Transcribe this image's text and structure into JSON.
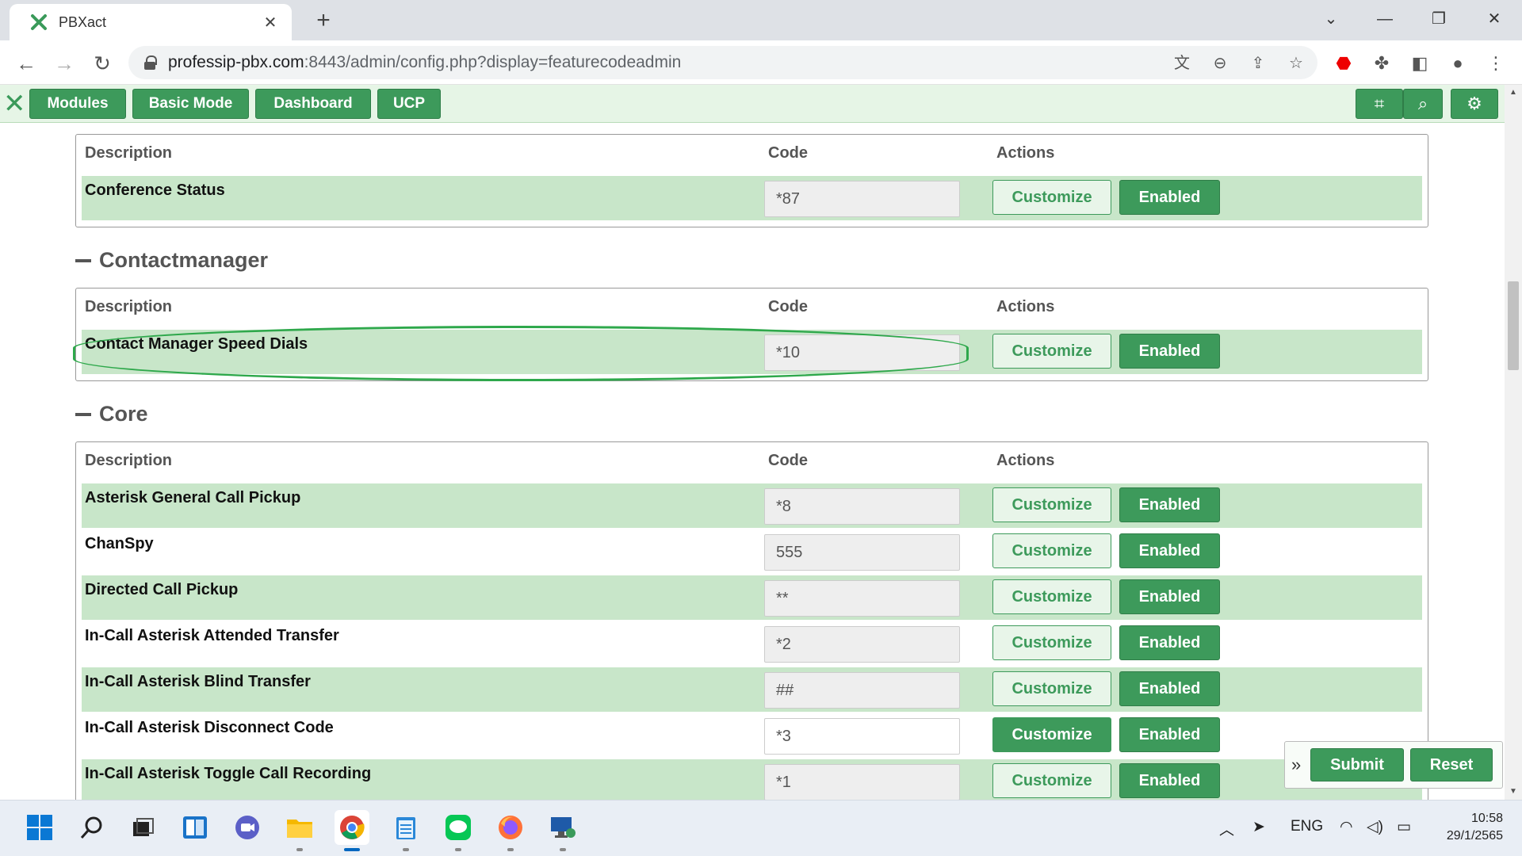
{
  "browser": {
    "tab_title": "PBXact",
    "url_host": "professip-pbx.com",
    "url_rest": ":8443/admin/config.php?display=featurecodeadmin"
  },
  "nav": {
    "modules": "Modules",
    "basic_mode": "Basic Mode",
    "dashboard": "Dashboard",
    "ucp": "UCP"
  },
  "headers": {
    "description": "Description",
    "code": "Code",
    "actions": "Actions"
  },
  "conference_panel": {
    "rows": [
      {
        "description": "Conference Status",
        "code": "*87"
      }
    ]
  },
  "contactmanager": {
    "title": "Contactmanager",
    "rows": [
      {
        "description": "Contact Manager Speed Dials",
        "code": "*10"
      }
    ]
  },
  "core": {
    "title": "Core",
    "rows": [
      {
        "description": "Asterisk General Call Pickup",
        "code": "*8"
      },
      {
        "description": "ChanSpy",
        "code": "555"
      },
      {
        "description": "Directed Call Pickup",
        "code": "**"
      },
      {
        "description": "In-Call Asterisk Attended Transfer",
        "code": "*2"
      },
      {
        "description": "In-Call Asterisk Blind Transfer",
        "code": "##"
      },
      {
        "description": "In-Call Asterisk Disconnect Code",
        "code": "*3"
      },
      {
        "description": "In-Call Asterisk Toggle Call Recording",
        "code": "*1"
      }
    ]
  },
  "buttons": {
    "customize": "Customize",
    "enabled": "Enabled",
    "submit": "Submit",
    "reset": "Reset"
  },
  "taskbar": {
    "lang": "ENG",
    "time": "10:58",
    "date": "29/1/2565"
  },
  "colors": {
    "accent": "#3d9a5b",
    "row_shade": "#c8e6c9",
    "highlight": "#2ea84b"
  }
}
